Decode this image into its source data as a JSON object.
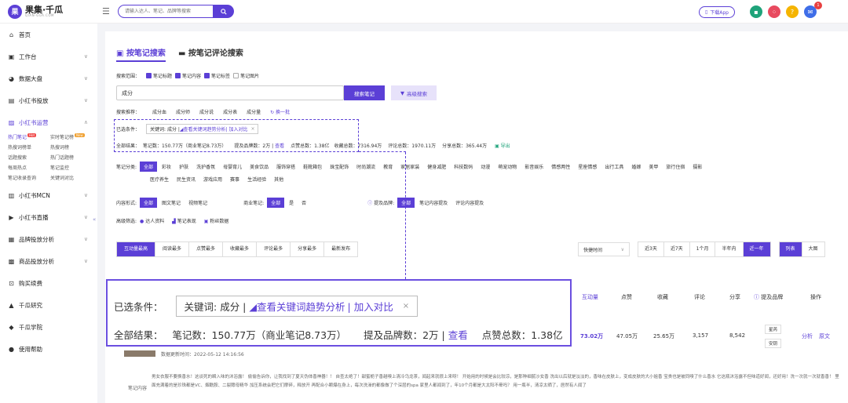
{
  "brand": {
    "name": "果集·千瓜",
    "domain": "QIAN-GUA.COM",
    "logo_char": "果"
  },
  "header": {
    "search_placeholder": "请输入达人、笔记、品牌等搜索",
    "download": "下载App",
    "notif_count": "1"
  },
  "sidebar": {
    "items": [
      {
        "label": "首页",
        "icon": "home-icon"
      },
      {
        "label": "工作台",
        "icon": "workbench-icon"
      },
      {
        "label": "数据大盘",
        "icon": "dashboard-icon"
      },
      {
        "label": "小红书投放",
        "icon": "ads-icon"
      },
      {
        "label": "小红书运营",
        "icon": "operate-icon"
      }
    ],
    "sub": [
      "热门笔记",
      "实时笔记榜",
      "热搜词榜单",
      "热搜词榜",
      "话题搜索",
      "热门话题榜",
      "每周热点",
      "笔记监控",
      "笔记收录查询",
      "关键词对比"
    ],
    "sub_tags": {
      "hot": "Hot",
      "new": "New"
    },
    "items2": [
      {
        "label": "小红书MCN",
        "icon": "mcn-icon"
      },
      {
        "label": "小红书直播",
        "icon": "live-icon"
      },
      {
        "label": "品牌投放分析",
        "icon": "brand-icon"
      },
      {
        "label": "商品投放分析",
        "icon": "goods-icon"
      },
      {
        "label": "购买续费",
        "icon": "cart-icon"
      },
      {
        "label": "千瓜研究",
        "icon": "research-icon"
      },
      {
        "label": "千瓜学院",
        "icon": "academy-icon"
      },
      {
        "label": "使用帮助",
        "icon": "help-icon"
      }
    ]
  },
  "tabs": [
    "按笔记搜索",
    "按笔记评论搜索"
  ],
  "scope": {
    "label": "搜索范围：",
    "opts": [
      "笔记标题",
      "笔记内容",
      "笔记标签",
      "笔记图片"
    ]
  },
  "keyword": "成分",
  "search_btn": "搜索笔记",
  "advanced_btn": "高级搜索",
  "recommend": {
    "label": "搜索推荐：",
    "items": [
      "成分血",
      "成分师",
      "成分说",
      "成分表",
      "成分量"
    ],
    "refresh": "换一批"
  },
  "selected": {
    "label": "已选条件：",
    "tag": "关键词: 成分 |",
    "trend": "查看关键词趋势分析",
    "compare": "| 加入对比",
    "close": "×"
  },
  "results": {
    "label": "全部结果：",
    "notes": "笔记数：150.77万（商业笔记8.73万）",
    "brands": "提及品牌数：",
    "brands_val": "2万",
    "view": "查看",
    "likes": "点赞总数：1.38亿",
    "collect": "收藏总数：7316.94万",
    "comments": "评论总数：1970.11万",
    "shares": "分享总数：365.44万",
    "export": "导出"
  },
  "categories": {
    "label": "笔记分类:",
    "all": "全部",
    "items": [
      "彩妆",
      "护肤",
      "洗护香氛",
      "母婴育儿",
      "美食饮品",
      "服饰穿搭",
      "鞋靴箱包",
      "珠宝配饰",
      "时尚潮流",
      "教育",
      "家居家装",
      "健身减肥",
      "科技数码",
      "动漫",
      "萌宠动物",
      "影音娱乐",
      "情感两性",
      "星座情感",
      "出行工具",
      "婚嫁",
      "美甲",
      "旅行住宿",
      "摄影"
    ],
    "items2": [
      "医疗养生",
      "民生资讯",
      "游戏应用",
      "赛事",
      "生活经验",
      "其他"
    ]
  },
  "format": {
    "label": "内容形式:",
    "all": "全部",
    "opts": [
      "图文笔记",
      "视频笔记"
    ]
  },
  "commercial": {
    "label": "商业笔记:",
    "all": "全部",
    "opts": [
      "是",
      "否"
    ]
  },
  "mention": {
    "label": "提及品牌:",
    "all": "全部",
    "opts": [
      "笔记内容提及",
      "评论内容提及"
    ]
  },
  "advanced": {
    "label": "高级筛选:",
    "opts": [
      "达人资料",
      "笔记表现",
      "粉丝数据"
    ]
  },
  "sort": [
    "互动量最高",
    "阅读最多",
    "点赞最多",
    "收藏最多",
    "评论最多",
    "分享最多",
    "最新发布"
  ],
  "time_select": "快捷时间",
  "time_opts": [
    "近3天",
    "近7天",
    "1个月",
    "半年内",
    "近一年"
  ],
  "view_opts": [
    "列表",
    "大图"
  ],
  "zoom": {
    "selected_label": "已选条件：",
    "tag": "关键词: 成分 |",
    "trend": "查看关键词趋势分析",
    "compare": "| 加入对比",
    "close": "×",
    "results_label": "全部结果：",
    "notes": "笔记数：150.77万（商业笔记8.73万）",
    "brands": "提及品牌数：2万 |",
    "view": "查看",
    "likes": "点赞总数：1.38亿"
  },
  "table": {
    "headers": [
      "互动量",
      "点赞",
      "收藏",
      "评论",
      "分享",
      "提及品牌",
      "操作"
    ],
    "row": [
      "73.02万",
      "47.05万",
      "25.65万",
      "3,157",
      "8,542"
    ],
    "brand_tags": [
      "星芮",
      "安钥"
    ],
    "actions": [
      "分析",
      "原文"
    ]
  },
  "row_meta": {
    "updated": "数据更新时间：2022-05-12 14:16:56",
    "content_label": "笔记内容",
    "content": "男女衣服不要换香水！这谈死的瞬入味的沐浴露！ 偷偷告诉你，让我找到了夏天伪体香神器！！ 自查太绝了！甜蜜栀子香越嗅上清冷乌龙茶，闻起来就很上来呀！ 开始用的时候是会比较凉，是那种细腻沙女香 洗出以后就是淡淡的，香味在皮肤上，变成皮肤的大小姐香 宝贵也是被同嗅了什么香水 它这瓶沐浴露不但味道好闻，还好用！洗一次就一次就香香！ 里面充满着的是珍珠都是VC、烟酰胺、二裂酵母精华 加压系统会把它们摩碎，释放开 再配合小颗爆在身上，每次洗澡的都像做了个深层的spa 家里人都闻到了，年10个月都是大太阳不晕吗？ 用一瓶半，清凉太晒了，居然有人闻了"
  }
}
